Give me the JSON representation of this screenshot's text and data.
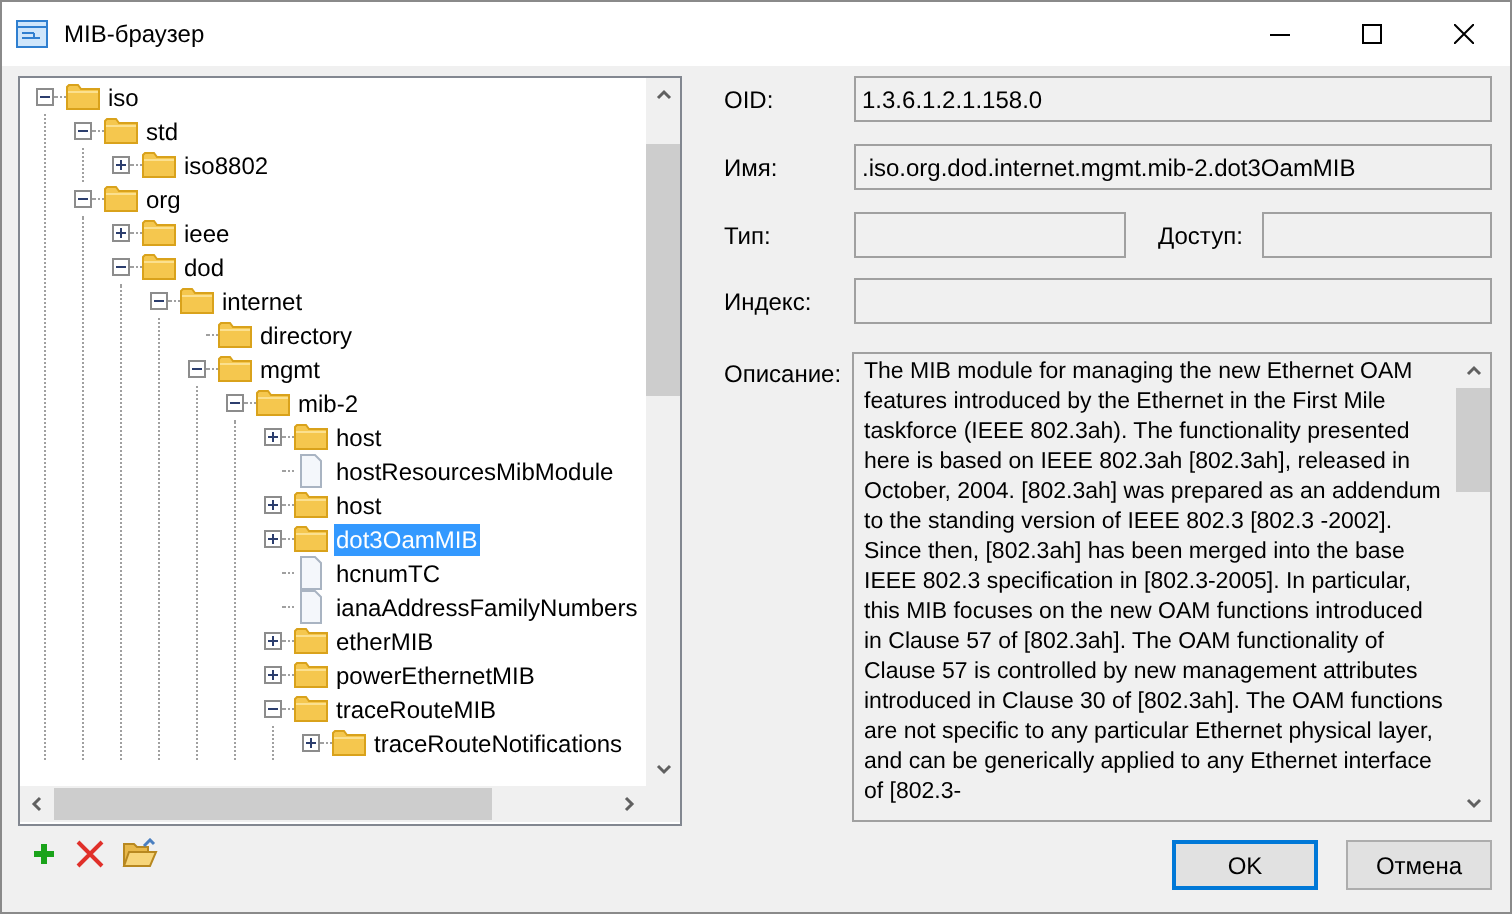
{
  "window": {
    "title": "MIB-браузер"
  },
  "tree": [
    {
      "label": "iso",
      "kind": "folder",
      "expanded": true,
      "selected": false,
      "children": [
        {
          "label": "std",
          "kind": "folder",
          "expanded": true,
          "selected": false,
          "children": [
            {
              "label": "iso8802",
              "kind": "folder",
              "expanded": false,
              "selected": false
            }
          ]
        },
        {
          "label": "org",
          "kind": "folder",
          "expanded": true,
          "selected": false,
          "children": [
            {
              "label": "ieee",
              "kind": "folder",
              "expanded": false,
              "selected": false
            },
            {
              "label": "dod",
              "kind": "folder",
              "expanded": true,
              "selected": false,
              "children": [
                {
                  "label": "internet",
                  "kind": "folder",
                  "expanded": true,
                  "selected": false,
                  "children": [
                    {
                      "label": "directory",
                      "kind": "folder",
                      "selected": false
                    },
                    {
                      "label": "mgmt",
                      "kind": "folder",
                      "expanded": true,
                      "selected": false,
                      "children": [
                        {
                          "label": "mib-2",
                          "kind": "folder",
                          "expanded": true,
                          "selected": false,
                          "children": [
                            {
                              "label": "host",
                              "kind": "folder",
                              "expanded": false,
                              "selected": false
                            },
                            {
                              "label": "hostResourcesMibModule",
                              "kind": "file",
                              "selected": false
                            },
                            {
                              "label": "host",
                              "kind": "folder",
                              "expanded": false,
                              "selected": false
                            },
                            {
                              "label": "dot3OamMIB",
                              "kind": "folder",
                              "expanded": false,
                              "selected": true
                            },
                            {
                              "label": "hcnumTC",
                              "kind": "file",
                              "selected": false
                            },
                            {
                              "label": "ianaAddressFamilyNumbers",
                              "kind": "file",
                              "selected": false
                            },
                            {
                              "label": "etherMIB",
                              "kind": "folder",
                              "expanded": false,
                              "selected": false
                            },
                            {
                              "label": "powerEthernetMIB",
                              "kind": "folder",
                              "expanded": false,
                              "selected": false
                            },
                            {
                              "label": "traceRouteMIB",
                              "kind": "folder",
                              "expanded": true,
                              "selected": false,
                              "children": [
                                {
                                  "label": "traceRouteNotifications",
                                  "kind": "folder",
                                  "expanded": false,
                                  "selected": false
                                }
                              ]
                            }
                          ]
                        }
                      ]
                    }
                  ]
                }
              ]
            }
          ]
        }
      ]
    }
  ],
  "details": {
    "oid": {
      "label": "OID:",
      "value": "1.3.6.1.2.1.158.0"
    },
    "name": {
      "label": "Имя:",
      "value": ".iso.org.dod.internet.mgmt.mib-2.dot3OamMIB"
    },
    "type": {
      "label": "Тип:"
    },
    "access": {
      "label": "Доступ:"
    },
    "index": {
      "label": "Индекс:"
    },
    "description": {
      "label": "Описание:",
      "value": "The MIB module for managing the new Ethernet OAM features introduced by the Ethernet in the First Mile taskforce (IEEE 802.3ah).  The functionality presented here is based on IEEE 802.3ah [802.3ah], released in October, 2004.  [802.3ah] was prepared as an addendum to the standing version of IEEE 802.3 [802.3 -2002].  Since then, [802.3ah] has been merged into the base IEEE 802.3 specification in [802.3-2005].  In particular, this MIB focuses on the new OAM functions introduced in Clause 57 of [802.3ah].  The OAM functionality of Clause 57 is controlled by new management attributes introduced in Clause 30 of [802.3ah].  The OAM functions are not specific to any particular Ethernet physical layer, and can be generically applied to any Ethernet interface of [802.3-"
    }
  },
  "buttons": [
    {
      "label": "OK",
      "default": true
    },
    {
      "label": "Отмена",
      "default": false
    }
  ]
}
